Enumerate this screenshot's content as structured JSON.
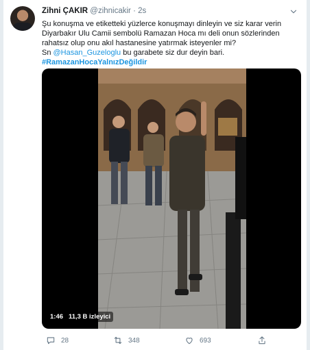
{
  "tweet": {
    "author_name": "Zihni ÇAKIR",
    "author_handle": "@zihnicakir",
    "separator": "·",
    "time": "2s",
    "text_line1": "Şu konuşma ve etiketteki yüzlerce konuşmayı dinleyin ve siz karar verin",
    "text_line2": "Diyarbakır Ulu Camii sembolü Ramazan Hoca mı deli onun sözlerinden",
    "text_line3": "rahatsız olup onu akıl hastanesine yatırmak isteyenler mi?",
    "text_line4_prefix": "Sn ",
    "mention": "@Hasan_Guzeloglu",
    "text_line4_suffix": " bu garabete siz dur deyin bari.",
    "hashtag": "#RamazanHocaYalnızDeğildir"
  },
  "video": {
    "duration": "1:46",
    "views": "11,3 B izleyici"
  },
  "actions": {
    "replies": "28",
    "retweets": "348",
    "likes": "693"
  },
  "icons": {
    "menu": "chevron-down-icon",
    "reply": "reply-icon",
    "retweet": "retweet-icon",
    "like": "heart-icon",
    "share": "share-icon"
  },
  "colors": {
    "link": "#1b95e0",
    "muted": "#657786",
    "background": "#e6ecf0"
  }
}
